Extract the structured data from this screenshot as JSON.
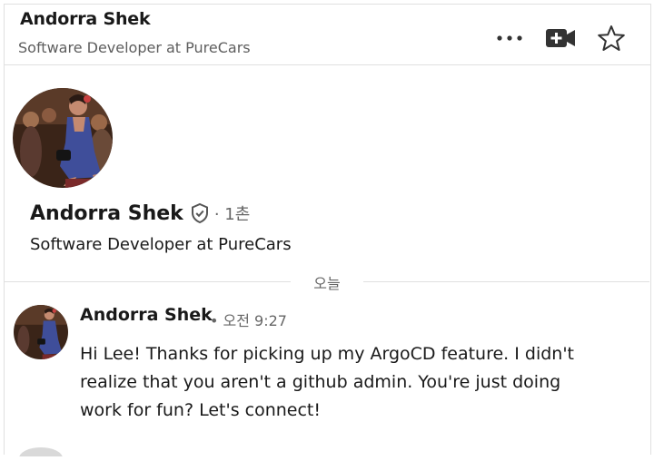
{
  "header": {
    "name": "Andorra Shek",
    "subtitle": "Software Developer at PureCars",
    "actions": [
      {
        "name": "more-icon"
      },
      {
        "name": "video-icon"
      },
      {
        "name": "star-icon"
      }
    ]
  },
  "profile": {
    "name": "Andorra Shek",
    "degree": "· 1촌",
    "headline": "Software Developer at PureCars",
    "verified_icon": "shield-check-icon"
  },
  "divider": {
    "label": "오늘"
  },
  "message": {
    "sender": "Andorra Shek",
    "time": "• 오전 9:27",
    "text": "Hi Lee! Thanks for picking up my ArgoCD feature. I didn't realize that you aren't a github admin. You're just doing work for fun? Let's connect!"
  },
  "colors": {
    "border": "#e0e0e0",
    "text": "#191919",
    "muted": "#666666"
  }
}
